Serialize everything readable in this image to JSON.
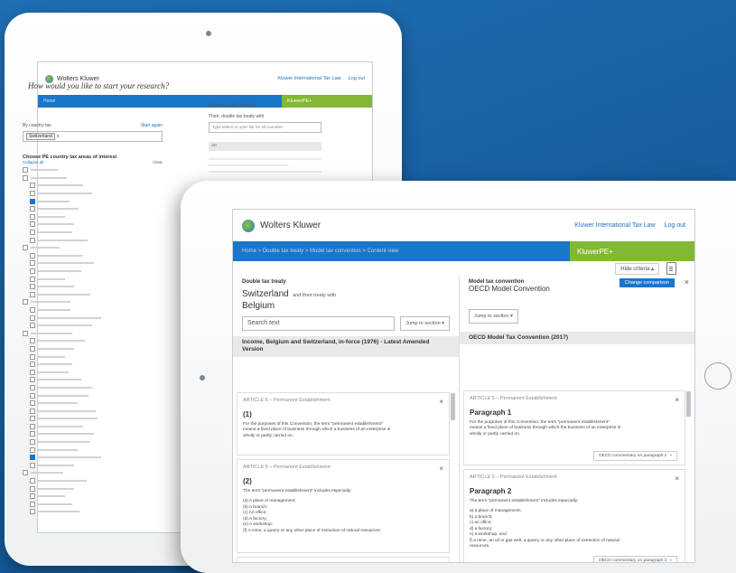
{
  "brand": {
    "logo_text": "Wolters Kluwer",
    "product": "KluwerPE+",
    "accent_blue": "#1a76c9",
    "accent_green": "#82b833"
  },
  "header_links": {
    "itl": "Kluwer International Tax Law",
    "logout": "Log out"
  },
  "back": {
    "nav_text": "Home",
    "question": "How would you like to start your research?",
    "by_country_label": "By country tax",
    "start_again": "Start again",
    "country_chip": "Switzerland",
    "chip_x": "x",
    "compare_label": "Compare with (optional)",
    "treaty_label": "Then: double tax treaty with",
    "treaty_placeholder": "Type letters or open list for all countries",
    "gray_bar": "OR",
    "list_head": "Choose PE country tax areas of interest",
    "list_sub": "Collapse all",
    "list_sub_right": "Clear"
  },
  "front": {
    "breadcrumb": "Home > Double tax treaty > Model tax convention > Content view",
    "hide_criteria": "Hide criteria",
    "left": {
      "label": "Double tax treaty",
      "country": "Switzerland",
      "and_treaty": "and their treaty with",
      "partner": "Belgium",
      "search_placeholder": "Search text",
      "jump": "Jump to section",
      "treaty_title": "Income, Belgium and Switzerland, in-force (1976) - Latest Amended Version",
      "cards": [
        {
          "article": "ARTICLE 5 – Permanent Establishment",
          "para": "(1)",
          "lines": [
            "For the purposes of this Convention, the term \"permanent establishment\"",
            "means a fixed place of business through which a business of an enterprise is",
            "wholly or partly carried on."
          ]
        },
        {
          "article": "ARTICLE 5 – Permanent Establishment",
          "para": "(2)",
          "lines": [
            "The term \"permanent establishment\" includes especially:",
            "",
            "(a) A place of management;",
            "(b) A branch;",
            "(c) An office;",
            "(d) A factory;",
            "(e) A workshop;",
            "(f) A mine, a quarry or any other place of extraction of natural resources;"
          ]
        },
        {
          "article": "ARTICLE 5 – Permanent Establishment",
          "para": "(3)",
          "lines": []
        }
      ]
    },
    "right": {
      "label": "Model tax convention",
      "name": "OECD Model Convention",
      "change_btn": "Change comparison",
      "jump": "Jump to section",
      "title": "OECD Model Tax Convention (2017)",
      "cards": [
        {
          "article": "ARTICLE 5 – Permanent Establishment",
          "para": "Paragraph 1",
          "lines": [
            "For the purposes of this Convention, the term \"permanent establishment\"",
            "means a fixed place of business through which the business of an enterprise is",
            "wholly or partly carried on."
          ],
          "commentary": "OECD commentary on paragraph 1"
        },
        {
          "article": "ARTICLE 5 – Permanent Establishment",
          "para": "Paragraph 2",
          "lines": [
            "The term \"permanent establishment\" includes especially:",
            "",
            "a) a place of management;",
            "b) a branch;",
            "c) an office;",
            "d) a factory;",
            "e) a workshop, and",
            "f) a mine, an oil or gas well, a quarry or any other place of extraction of natural",
            "   resources."
          ],
          "commentary": "OECD commentary on paragraph 2"
        }
      ]
    }
  },
  "icons": {
    "close": "×",
    "arrow": "»",
    "caret": "▾"
  }
}
